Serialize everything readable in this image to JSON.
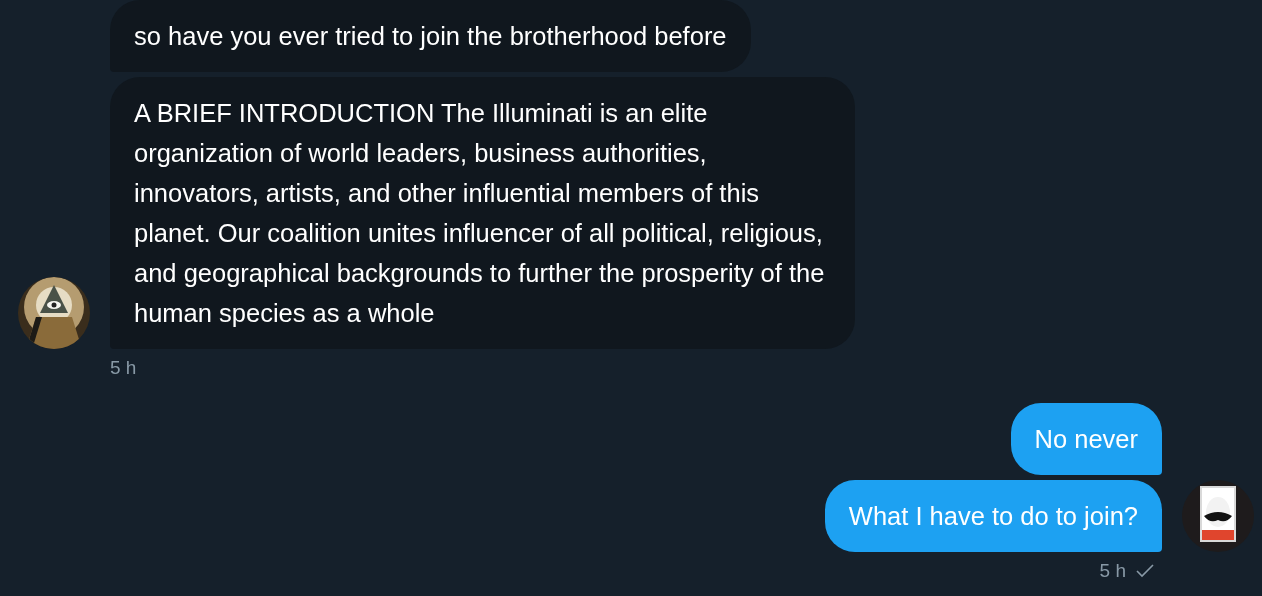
{
  "conversation": [
    {
      "kind": "received",
      "messages": [
        "so have you ever tried to join the brotherhood before",
        "A BRIEF INTRODUCTION The Illuminati is an elite organization of world leaders, business authorities, innovators, artists, and other influential members of this planet. Our coalition unites influencer of all political, religious, and geographical backgrounds to further the prosperity of the human species as a whole"
      ],
      "time": "5 h",
      "seen": false
    },
    {
      "kind": "sent",
      "messages": [
        "No never",
        "What I have to do to join?"
      ],
      "time": "5 h",
      "seen": true
    }
  ]
}
